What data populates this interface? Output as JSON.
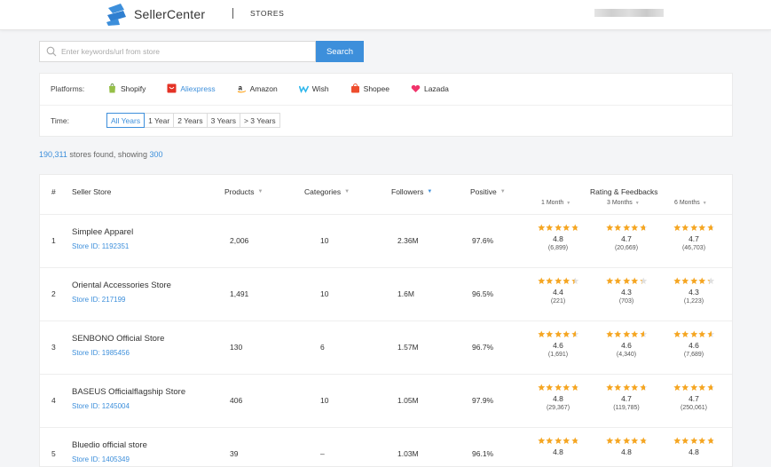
{
  "header": {
    "brand": "SellerCenter",
    "nav": "STORES"
  },
  "search": {
    "placeholder": "Enter keywords/url from store",
    "button": "Search"
  },
  "filters": {
    "platforms_label": "Platforms:",
    "platforms": [
      {
        "label": "Shopify",
        "icon": "shopify-icon",
        "active": false
      },
      {
        "label": "Aliexpress",
        "icon": "aliexpress-icon",
        "active": true
      },
      {
        "label": "Amazon",
        "icon": "amazon-icon",
        "active": false
      },
      {
        "label": "Wish",
        "icon": "wish-icon",
        "active": false
      },
      {
        "label": "Shopee",
        "icon": "shopee-icon",
        "active": false
      },
      {
        "label": "Lazada",
        "icon": "lazada-icon",
        "active": false
      }
    ],
    "time_label": "Time:",
    "time_options": [
      {
        "label": "All Years",
        "active": true
      },
      {
        "label": "1 Year",
        "active": false
      },
      {
        "label": "2 Years",
        "active": false
      },
      {
        "label": "3 Years",
        "active": false
      },
      {
        "label": "> 3 Years",
        "active": false
      }
    ]
  },
  "summary": {
    "count": "190,311",
    "middle": "stores found, showing",
    "showing": "300"
  },
  "table": {
    "headers": {
      "index": "#",
      "store": "Seller Store",
      "products": "Products",
      "categories": "Categories",
      "followers": "Followers",
      "positive": "Positive",
      "rating": "Rating & Feedbacks",
      "m1": "1 Month",
      "m3": "3 Months",
      "m6": "6 Months"
    },
    "rows": [
      {
        "index": "1",
        "name": "Simplee Apparel",
        "store_id": "Store ID: 1192351",
        "products": "2,006",
        "categories": "10",
        "followers": "2.36M",
        "positive": "97.6%",
        "ratings": [
          {
            "value": "4.8",
            "count": "(6,899)"
          },
          {
            "value": "4.7",
            "count": "(20,669)"
          },
          {
            "value": "4.7",
            "count": "(46,703)"
          }
        ]
      },
      {
        "index": "2",
        "name": "Oriental Accessories Store",
        "store_id": "Store ID: 217199",
        "products": "1,491",
        "categories": "10",
        "followers": "1.6M",
        "positive": "96.5%",
        "ratings": [
          {
            "value": "4.4",
            "count": "(221)"
          },
          {
            "value": "4.3",
            "count": "(703)"
          },
          {
            "value": "4.3",
            "count": "(1,223)"
          }
        ]
      },
      {
        "index": "3",
        "name": "SENBONO Official Store",
        "store_id": "Store ID: 1985456",
        "products": "130",
        "categories": "6",
        "followers": "1.57M",
        "positive": "96.7%",
        "ratings": [
          {
            "value": "4.6",
            "count": "(1,691)"
          },
          {
            "value": "4.6",
            "count": "(4,340)"
          },
          {
            "value": "4.6",
            "count": "(7,689)"
          }
        ]
      },
      {
        "index": "4",
        "name": "BASEUS Officialflagship Store",
        "store_id": "Store ID: 1245004",
        "products": "406",
        "categories": "10",
        "followers": "1.05M",
        "positive": "97.9%",
        "ratings": [
          {
            "value": "4.8",
            "count": "(29,367)"
          },
          {
            "value": "4.7",
            "count": "(119,785)"
          },
          {
            "value": "4.7",
            "count": "(250,061)"
          }
        ]
      },
      {
        "index": "5",
        "name": "Bluedio official store",
        "store_id": "Store ID: 1405349",
        "products": "39",
        "categories": "–",
        "followers": "1.03M",
        "positive": "96.1%",
        "ratings": [
          {
            "value": "4.8",
            "count": ""
          },
          {
            "value": "4.8",
            "count": ""
          },
          {
            "value": "4.8",
            "count": ""
          }
        ]
      }
    ]
  },
  "colors": {
    "accent": "#3d8fdb",
    "star": "#f5a623",
    "star_empty": "#e0e0e0"
  }
}
